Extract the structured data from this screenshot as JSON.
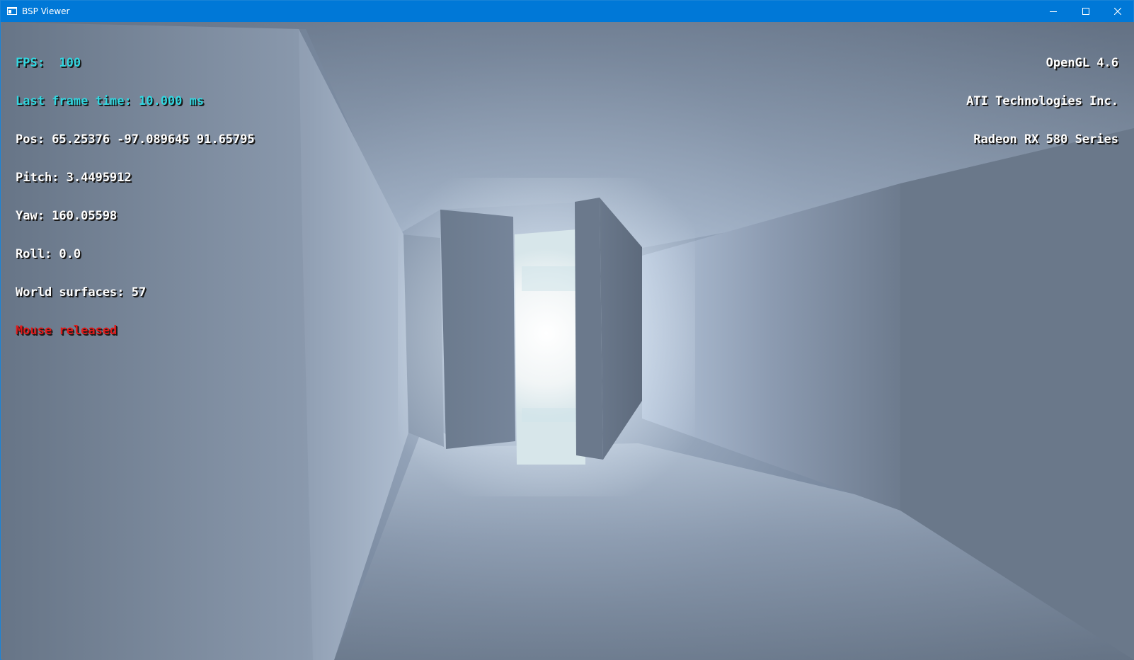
{
  "window": {
    "title": "BSP Viewer",
    "app_icon": "app-window-icon",
    "controls": {
      "minimize_icon": "minimize-icon",
      "maximize_icon": "maximize-icon",
      "close_icon": "close-icon"
    }
  },
  "hud": {
    "stats": {
      "fps": "FPS:  100",
      "frame_time": "Last frame time: 10.000 ms",
      "pos": "Pos: 65.25376 -97.089645 91.65795",
      "pitch": "Pitch: 3.4495912",
      "yaw": "Yaw: 160.05598",
      "roll": "Roll: 0.0",
      "surfaces": "World surfaces: 57",
      "mouse_status": "Mouse released"
    },
    "renderer": {
      "api": "OpenGL 4.6",
      "vendor": "ATI Technologies Inc.",
      "device": "Radeon RX 580 Series"
    }
  },
  "colors": {
    "titlebar": "#0078d7",
    "hud_highlight": "#33d6e0",
    "hud_text": "#ffffff",
    "hud_warning": "#e01b1b",
    "scene_fog": "#8090a6"
  }
}
